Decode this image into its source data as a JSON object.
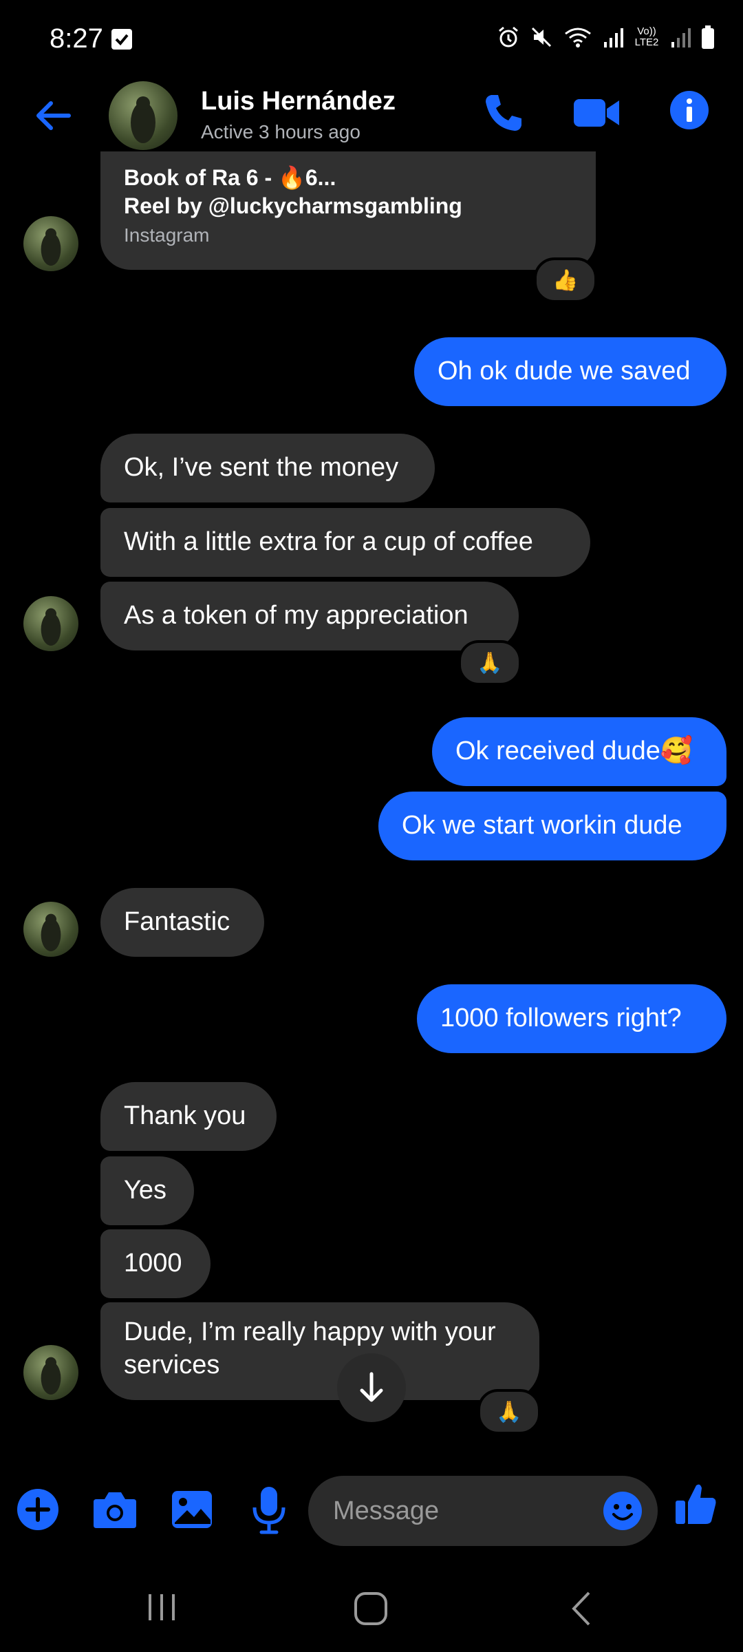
{
  "status": {
    "time": "8:27",
    "network_label": "Vo)) LTE2"
  },
  "header": {
    "contact_name": "Luis Hernández",
    "presence": "Active 3 hours ago"
  },
  "messages": {
    "shared_title": "Book of Ra 6 - 🔥6...",
    "shared_subtitle": "Reel by @luckycharmsgambling",
    "shared_source": "Instagram",
    "reaction_thumbs": "👍",
    "out_1": "Oh ok dude we saved",
    "in_1": "Ok, I’ve sent the money",
    "in_2": "With a little extra for a cup of coffee",
    "in_3": "As a token of my appreciation",
    "reaction_pray_1": "🙏",
    "out_2": "Ok received dude🥰",
    "out_3": "Ok we start workin dude",
    "in_4": "Fantastic",
    "out_4": "1000 followers right?",
    "in_5": "Thank you",
    "in_6": "Yes",
    "in_7": "1000",
    "in_8": "Dude, I’m really happy with your services",
    "reaction_pray_2": "🙏"
  },
  "composer": {
    "placeholder": "Message"
  },
  "colors": {
    "accent": "#1a66ff",
    "incoming_bubble": "#303030",
    "background": "#000000"
  }
}
